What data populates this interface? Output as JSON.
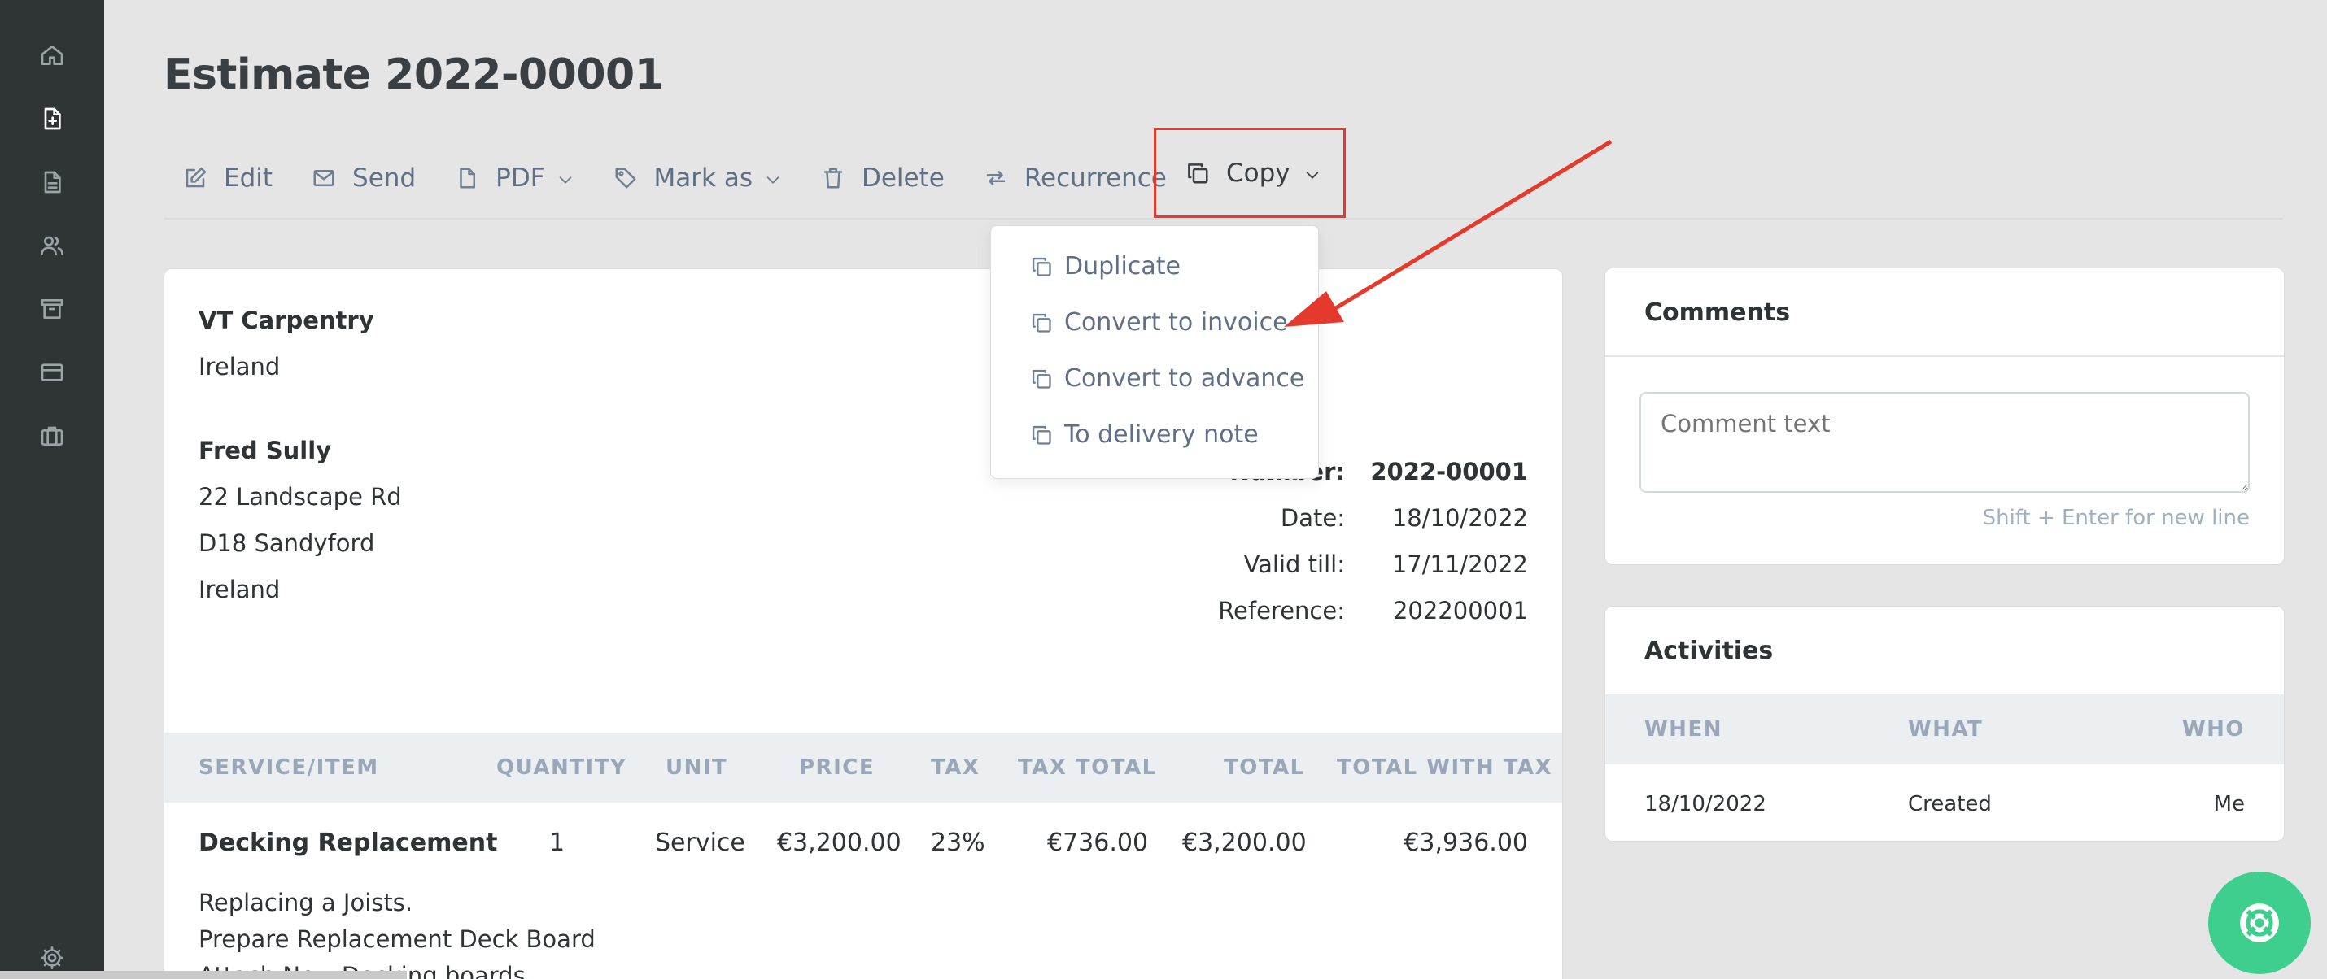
{
  "page": {
    "title": "Estimate 2022-00001"
  },
  "sidebar": {
    "items": [
      {
        "icon": "home-icon"
      },
      {
        "icon": "document-plus-icon",
        "active": true
      },
      {
        "icon": "document-icon"
      },
      {
        "icon": "users-icon"
      },
      {
        "icon": "archive-icon"
      },
      {
        "icon": "credit-card-icon"
      },
      {
        "icon": "briefcase-icon"
      },
      {
        "icon": "gear-icon"
      }
    ]
  },
  "toolbar": {
    "edit": "Edit",
    "send": "Send",
    "pdf": "PDF",
    "mark_as": "Mark as",
    "delete": "Delete",
    "recurrence": "Recurrence",
    "copy": "Copy"
  },
  "copy_menu": {
    "items": [
      "Duplicate",
      "Convert to invoice",
      "Convert to advance",
      "To delivery note"
    ]
  },
  "document": {
    "issuer": {
      "name": "VT Carpentry",
      "country": "Ireland"
    },
    "client": {
      "name": "Fred Sully",
      "line1": "22 Landscape Rd",
      "line2": "D18 Sandyford",
      "country": "Ireland"
    },
    "meta": [
      {
        "label": "Number:",
        "value": "2022-00001"
      },
      {
        "label": "Date:",
        "value": "18/10/2022"
      },
      {
        "label": "Valid till:",
        "value": "17/11/2022"
      },
      {
        "label": "Reference:",
        "value": "202200001"
      }
    ],
    "table": {
      "headers": [
        "SERVICE/ITEM",
        "QUANTITY",
        "UNIT",
        "PRICE",
        "TAX",
        "TAX TOTAL",
        "TOTAL",
        "TOTAL WITH TAX"
      ],
      "rows": [
        {
          "item": "Decking Replacement",
          "quantity": "1",
          "unit": "Service",
          "price": "€3,200.00",
          "tax": "23%",
          "tax_total": "€736.00",
          "total": "€3,200.00",
          "total_with_tax": "€3,936.00",
          "description": [
            "Replacing a Joists.",
            "Prepare Replacement Deck Board",
            "Attach New Decking boards"
          ]
        }
      ]
    }
  },
  "comments": {
    "title": "Comments",
    "placeholder": "Comment text",
    "hint": "Shift + Enter for new line"
  },
  "activities": {
    "title": "Activities",
    "headers": [
      "WHEN",
      "WHAT",
      "WHO"
    ],
    "rows": [
      {
        "when": "18/10/2022",
        "what": "Created",
        "who": "Me"
      }
    ]
  },
  "colors": {
    "sidebar_bg": "#2f3435",
    "page_bg": "#e5e5e5",
    "accent_link": "#5f6f85",
    "highlight_red": "#e43a2e",
    "help_green": "#3ecf8e"
  }
}
